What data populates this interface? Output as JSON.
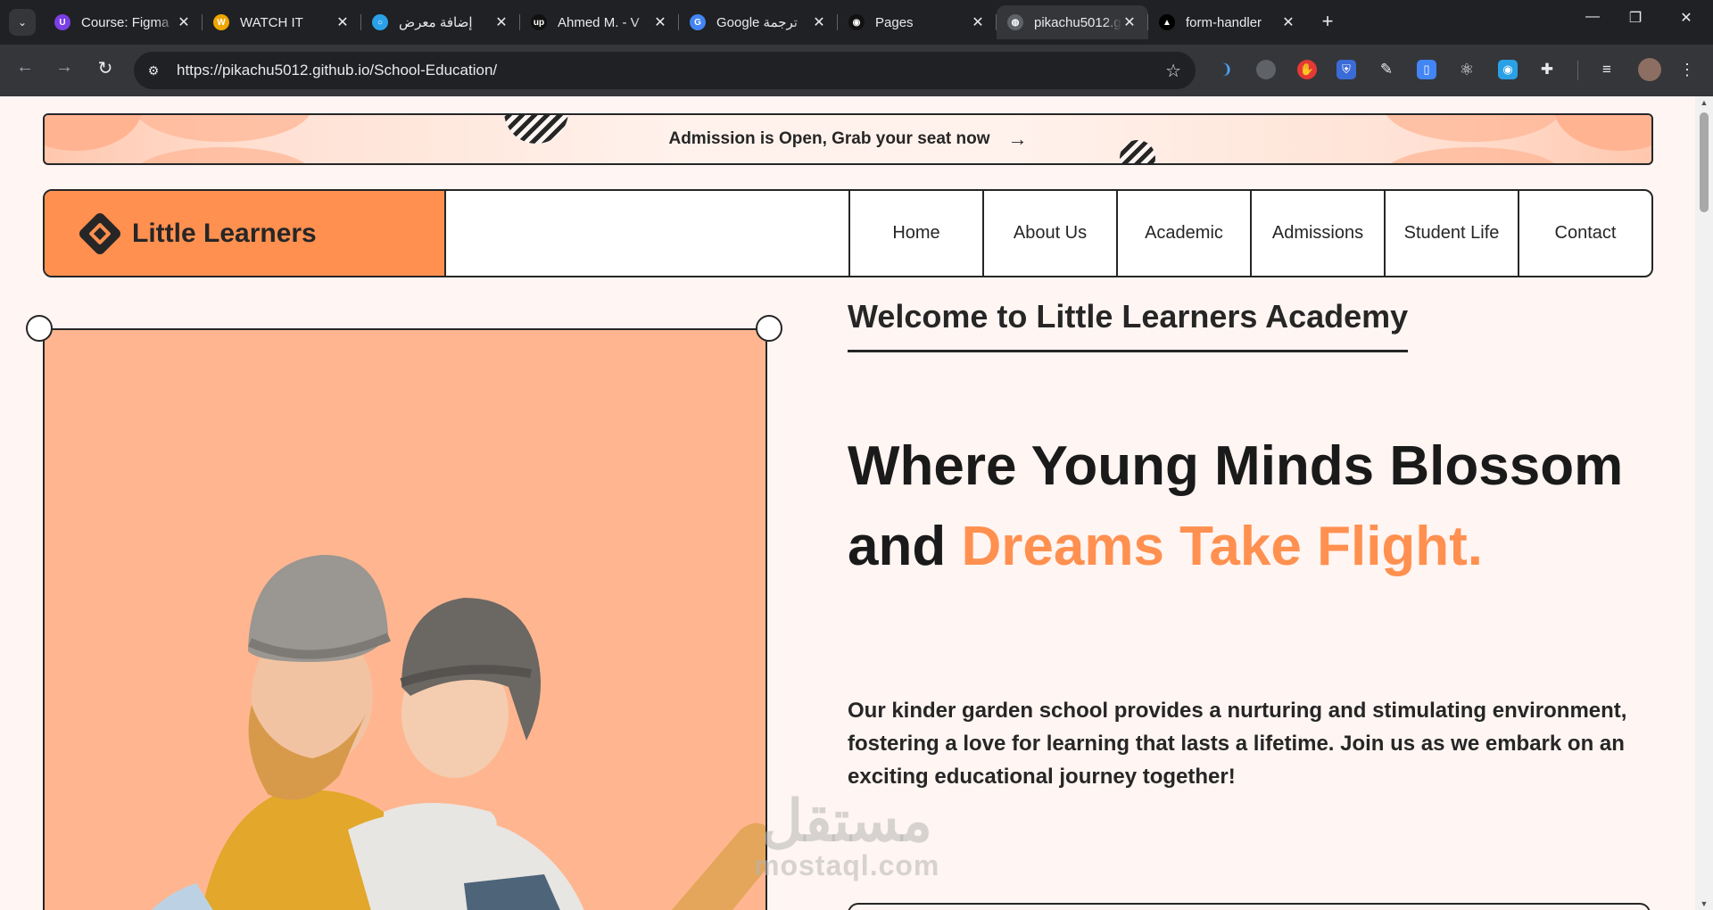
{
  "browser": {
    "tabs": [
      {
        "title": "Course: Figma",
        "favicon": "u-icon",
        "color": "#7b3fe4",
        "glyph": "U"
      },
      {
        "title": "WATCH IT",
        "favicon": "w-icon",
        "color": "#f0a500",
        "glyph": "W"
      },
      {
        "title": "إضافة معرض",
        "favicon": "circle-icon",
        "color": "#2aa1e6",
        "glyph": "○"
      },
      {
        "title": "Ahmed M. - V",
        "favicon": "up-icon",
        "color": "#111111",
        "glyph": "up"
      },
      {
        "title": "Google ترجمة",
        "favicon": "translate-icon",
        "color": "#4285f4",
        "glyph": "G"
      },
      {
        "title": "Pages",
        "favicon": "github-icon",
        "color": "#111111",
        "glyph": "◉"
      },
      {
        "title": "pikachu5012.g",
        "favicon": "globe-icon",
        "color": "#5f6368",
        "glyph": "◍",
        "active": true
      },
      {
        "title": "form-handler",
        "favicon": "triangle-icon",
        "color": "#000000",
        "glyph": "▲"
      }
    ],
    "url": "https://pikachu5012.github.io/School-Education/",
    "new_tab": "+",
    "close_glyph": "✕"
  },
  "page": {
    "banner": {
      "text": "Admission is Open, Grab your seat now",
      "arrow": "→"
    },
    "brand": {
      "name": "Little Learners"
    },
    "nav": [
      "Home",
      "About Us",
      "Academic",
      "Admissions",
      "Student Life",
      "Contact"
    ],
    "hero": {
      "kicker": "Welcome to Little Learners Academy",
      "title_main": "Where Young Minds Blossom and ",
      "title_accent": "Dreams Take Flight.",
      "body": "Our kinder garden school provides a nurturing and stimulating environment, fostering a love for learning that lasts a lifetime. Join us as we embark on an exciting educational journey together!"
    },
    "watermark": {
      "arabic": "مستقل",
      "latin": "mostaql.com"
    }
  },
  "colors": {
    "accent": "#ff9050",
    "dark": "#262626",
    "page_bg": "#fff5f2",
    "image_bg": "#ffb690"
  }
}
